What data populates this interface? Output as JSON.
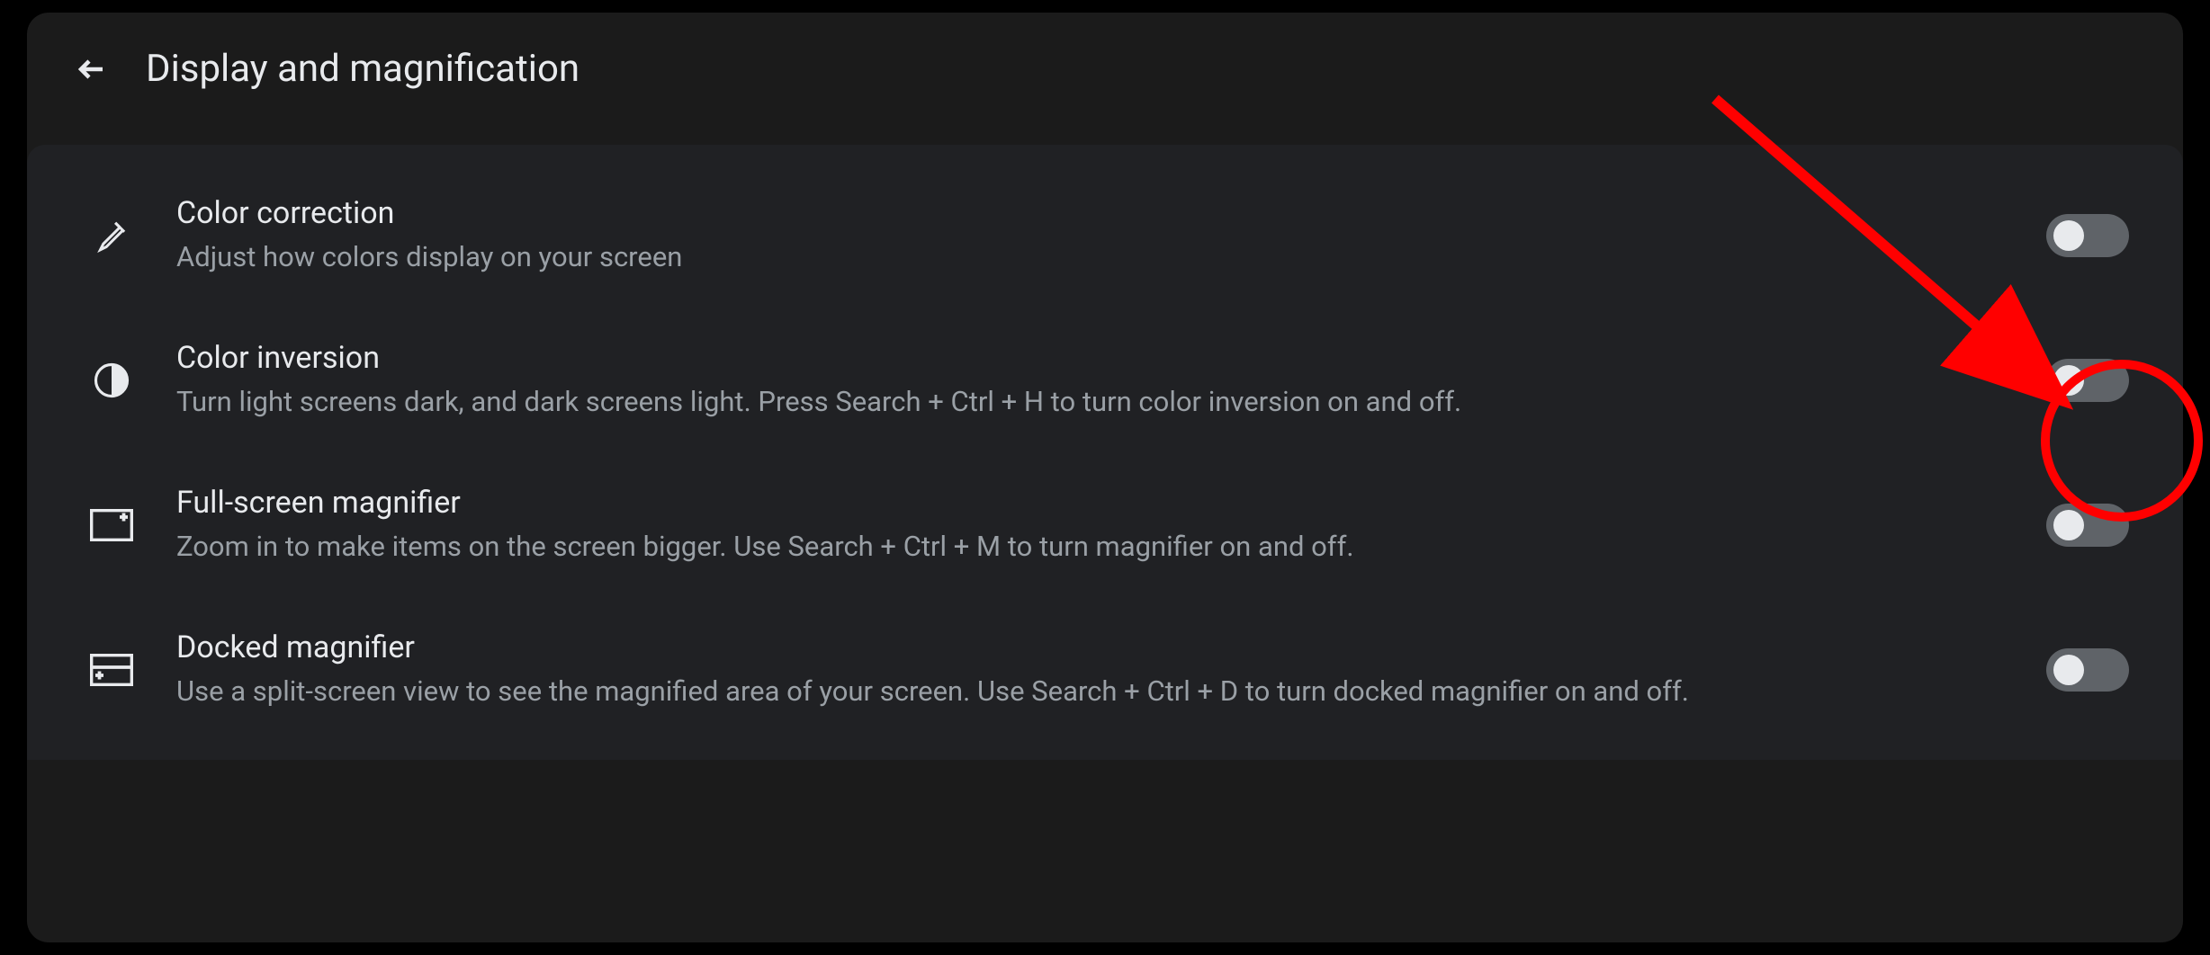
{
  "header": {
    "title": "Display and magnification"
  },
  "settings": [
    {
      "title": "Color correction",
      "description": "Adjust how colors display on your screen",
      "enabled": false
    },
    {
      "title": "Color inversion",
      "description": "Turn light screens dark, and dark screens light. Press Search + Ctrl + H to turn color inversion on and off.",
      "enabled": false
    },
    {
      "title": "Full-screen magnifier",
      "description": "Zoom in to make items on the screen bigger. Use Search + Ctrl + M to turn magnifier on and off.",
      "enabled": false
    },
    {
      "title": "Docked magnifier",
      "description": "Use a split-screen view to see the magnified area of your screen. Use Search + Ctrl + D to turn docked magnifier on and off.",
      "enabled": false
    }
  ],
  "annotation": {
    "color": "#ff0000",
    "target": "color-inversion-toggle"
  }
}
